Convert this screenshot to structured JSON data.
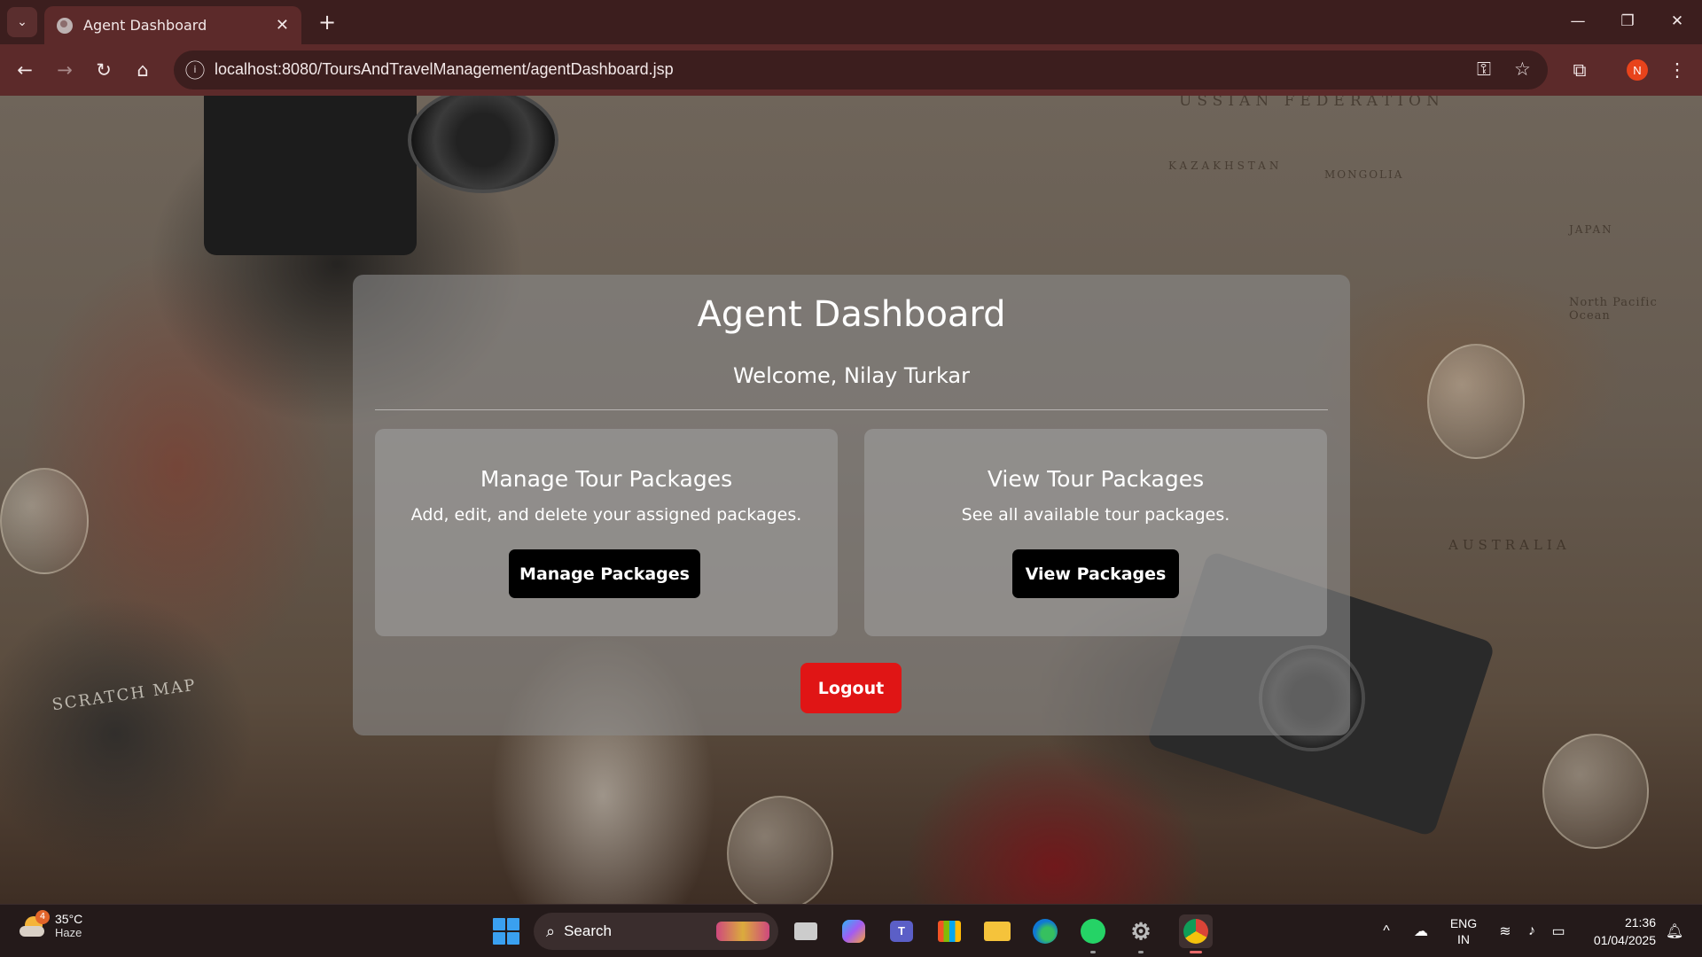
{
  "browser": {
    "tab_title": "Agent Dashboard",
    "url": "localhost:8080/ToursAndTravelManagement/agentDashboard.jsp",
    "profile_initial": "N"
  },
  "background": {
    "map_labels": [
      "USSIAN FEDERATION",
      "KAZAKHSTAN",
      "MONGOLIA",
      "JAPAN",
      "North Pacific Ocean",
      "AUSTRALIA",
      "SCRATCH MAP"
    ]
  },
  "dashboard": {
    "title": "Agent Dashboard",
    "welcome": "Welcome, Nilay Turkar",
    "cards": [
      {
        "title": "Manage Tour Packages",
        "description": "Add, edit, and delete your assigned packages.",
        "button_label": "Manage Packages"
      },
      {
        "title": "View Tour Packages",
        "description": "See all available tour packages.",
        "button_label": "View Packages"
      }
    ],
    "logout_label": "Logout"
  },
  "taskbar": {
    "weather_temp": "35°C",
    "weather_condition": "Haze",
    "weather_badge": "4",
    "search_label": "Search",
    "lang_primary": "ENG",
    "lang_secondary": "IN",
    "time": "21:36",
    "date": "01/04/2025"
  },
  "colors": {
    "tab_strip": "#3c1e1e",
    "toolbar": "#5c2a2a",
    "logout": "#e01515",
    "card_button": "#000000"
  }
}
